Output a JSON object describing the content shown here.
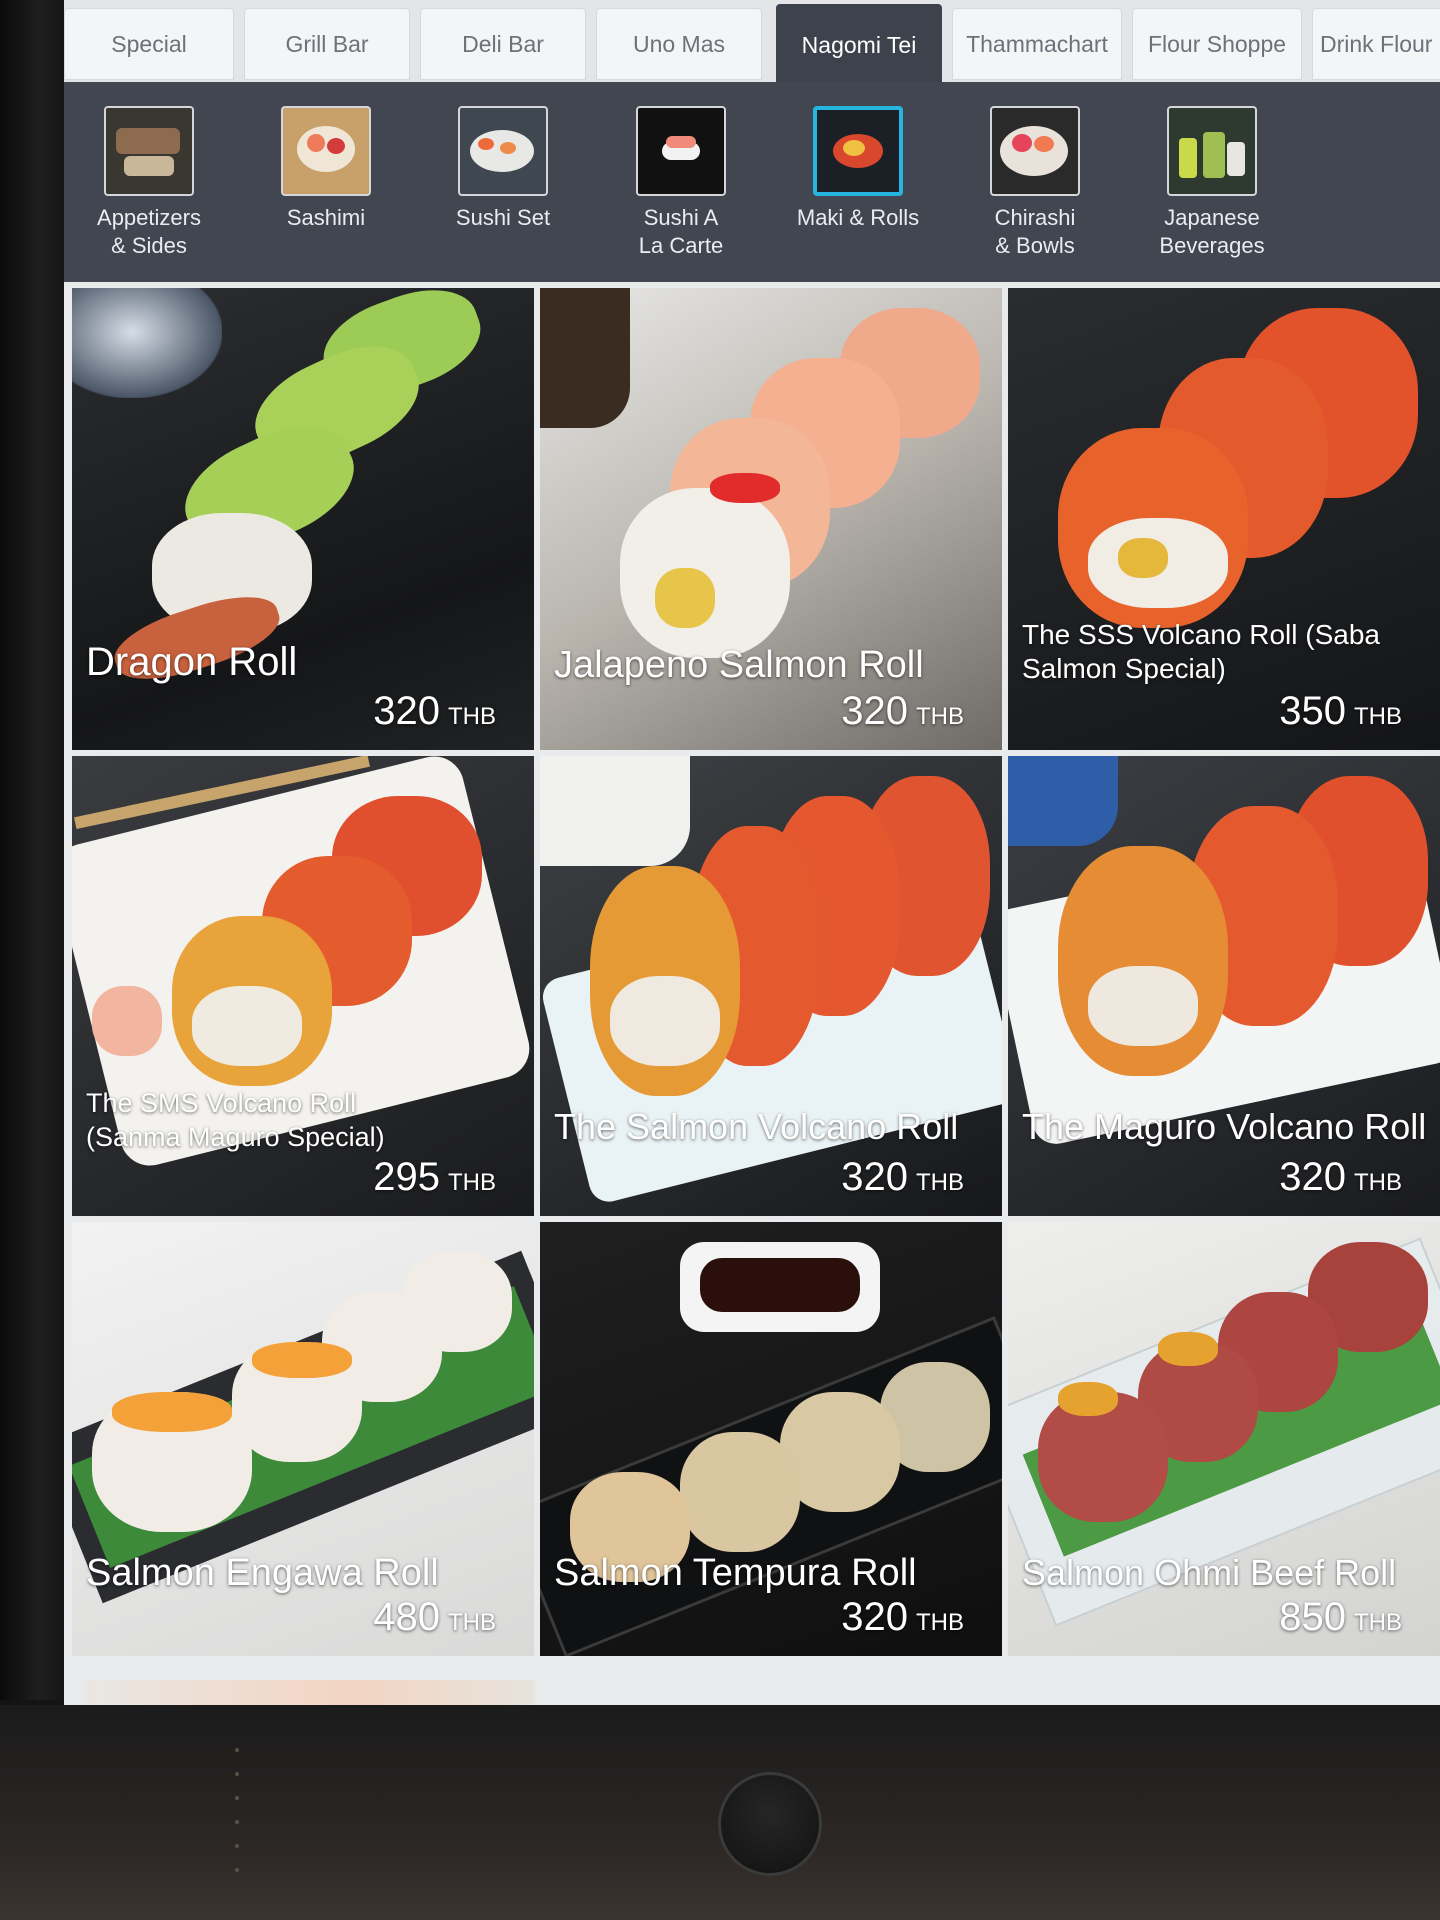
{
  "tabs": [
    {
      "label": "Special"
    },
    {
      "label": "Grill Bar"
    },
    {
      "label": "Deli Bar"
    },
    {
      "label": "Uno Mas"
    },
    {
      "label": "Nagomi Tei",
      "active": true
    },
    {
      "label": "Thammachart"
    },
    {
      "label": "Flour Shoppe"
    },
    {
      "label": "Drink Flour"
    }
  ],
  "categories": [
    {
      "label": "Appetizers\n& Sides"
    },
    {
      "label": "Sashimi"
    },
    {
      "label": "Sushi Set"
    },
    {
      "label": "Sushi A\nLa Carte"
    },
    {
      "label": "Maki & Rolls",
      "active": true
    },
    {
      "label": "Chirashi\n& Bowls"
    },
    {
      "label": "Japanese\nBeverages"
    }
  ],
  "currency": "THB",
  "menu_items": [
    {
      "name": "Dragon Roll",
      "price": "320"
    },
    {
      "name": "Jalapeno Salmon Roll",
      "price": "320"
    },
    {
      "name": "The SSS Volcano Roll (Saba\nSalmon Special)",
      "price": "350"
    },
    {
      "name": "The SMS Volcano Roll\n(Sanma Maguro Special)",
      "price": "295"
    },
    {
      "name": "The Salmon Volcano Roll",
      "price": "320"
    },
    {
      "name": "The Maguro Volcano Roll",
      "price": "320"
    },
    {
      "name": "Salmon Engawa Roll",
      "price": "480"
    },
    {
      "name": "Salmon Tempura Roll",
      "price": "320"
    },
    {
      "name": "Salmon Ohmi Beef Roll",
      "price": "850"
    }
  ],
  "colors": {
    "accent": "#25b6df",
    "nav_dark": "#414651",
    "tab_active": "#3d424c"
  }
}
